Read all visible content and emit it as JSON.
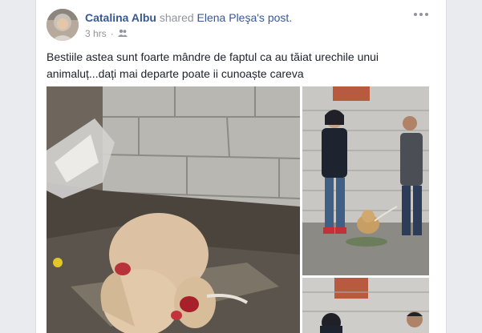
{
  "post": {
    "author": "Catalina Albu",
    "shared_text": "shared",
    "original_author": "Elena Pleşa",
    "original_suffix": "'s post.",
    "time": "3 hrs",
    "dot": "·",
    "audience_icon": "friends-icon",
    "text_line1": "Bestiile astea sunt foarte mândre de faptul ca au tăiat urechile unui",
    "text_line2": "animaluț...dați mai departe poate ii cunoaște careva"
  },
  "colors": {
    "link": "#365899",
    "meta": "#90949c",
    "text": "#1d2129",
    "background": "#e9ebee"
  },
  "icons": {
    "options": "more-options-icon"
  }
}
